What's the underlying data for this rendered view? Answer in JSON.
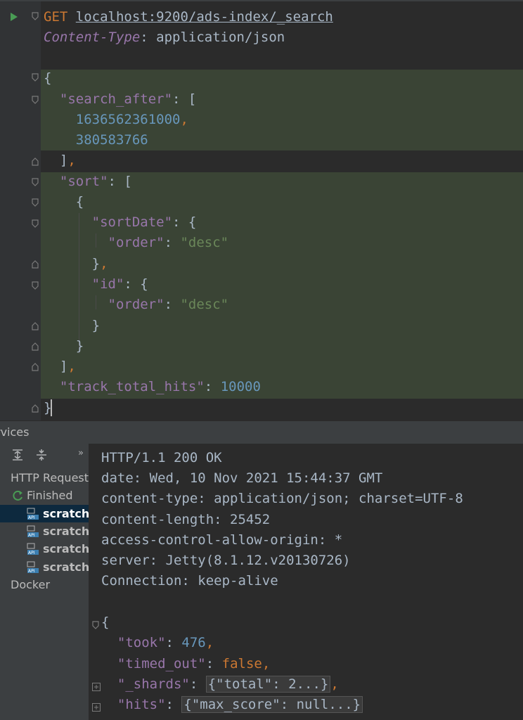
{
  "request": {
    "method": "GET",
    "url": "localhost:9200/ads-index/_search",
    "header_name": "Content-Type",
    "header_sep": ": ",
    "header_value": "application/json"
  },
  "body": {
    "search_after_key": "\"search_after\"",
    "search_after_values": [
      "1636562361000",
      "380583766"
    ],
    "sort_key": "\"sort\"",
    "sortDate_key": "\"sortDate\"",
    "order_key": "\"order\"",
    "order_value": "\"desc\"",
    "id_key": "\"id\"",
    "track_key": "\"track_total_hits\"",
    "track_value": "10000"
  },
  "services": {
    "title": "rvices",
    "tree": {
      "root": "HTTP Request",
      "finished": "Finished",
      "scratches": [
        "scratch.",
        "scratch.",
        "scratch.",
        "scratch."
      ],
      "docker": "Docker"
    }
  },
  "response": {
    "status": "HTTP/1.1 200 OK",
    "headers": [
      "date: Wed, 10 Nov 2021 15:44:37 GMT",
      "content-type: application/json; charset=UTF-8",
      "content-length: 25452",
      "access-control-allow-origin: *",
      "server: Jetty(8.1.12.v20130726)",
      "Connection: keep-alive"
    ],
    "took_key": "\"took\"",
    "took_value": "476",
    "timed_out_key": "\"timed_out\"",
    "timed_out_value": "false",
    "shards_key": "\"_shards\"",
    "shards_collapsed": "{\"total\": 2...}",
    "hits_key": "\"hits\"",
    "hits_collapsed": "{\"max_score\": null...}"
  },
  "colors": {
    "keyword": "#cc7832",
    "key": "#9876aa",
    "string": "#6a8759",
    "number": "#6897bb",
    "text": "#a9b7c6",
    "highlight": "#3a4435"
  },
  "icons": [
    "run-icon",
    "fold-icon",
    "expand-all-icon",
    "collapse-all-icon",
    "more-icon",
    "refresh-icon",
    "api-file-icon",
    "expand-icon"
  ]
}
